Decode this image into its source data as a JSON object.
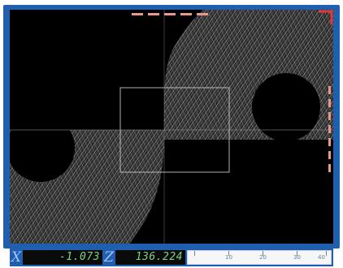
{
  "viewer": {
    "colors": {
      "frame": "#1f5fae",
      "screen": "#000000",
      "texture": "#d8d8d8",
      "marker": "#e89a8a",
      "corner_marker": "#e23a3a"
    }
  },
  "status_bar": {
    "x_label": "X",
    "x_value": "-1.073",
    "z_label": "Z",
    "z_value": "136.224",
    "ruler_labels": [
      "10",
      "20",
      "30",
      "40"
    ]
  }
}
